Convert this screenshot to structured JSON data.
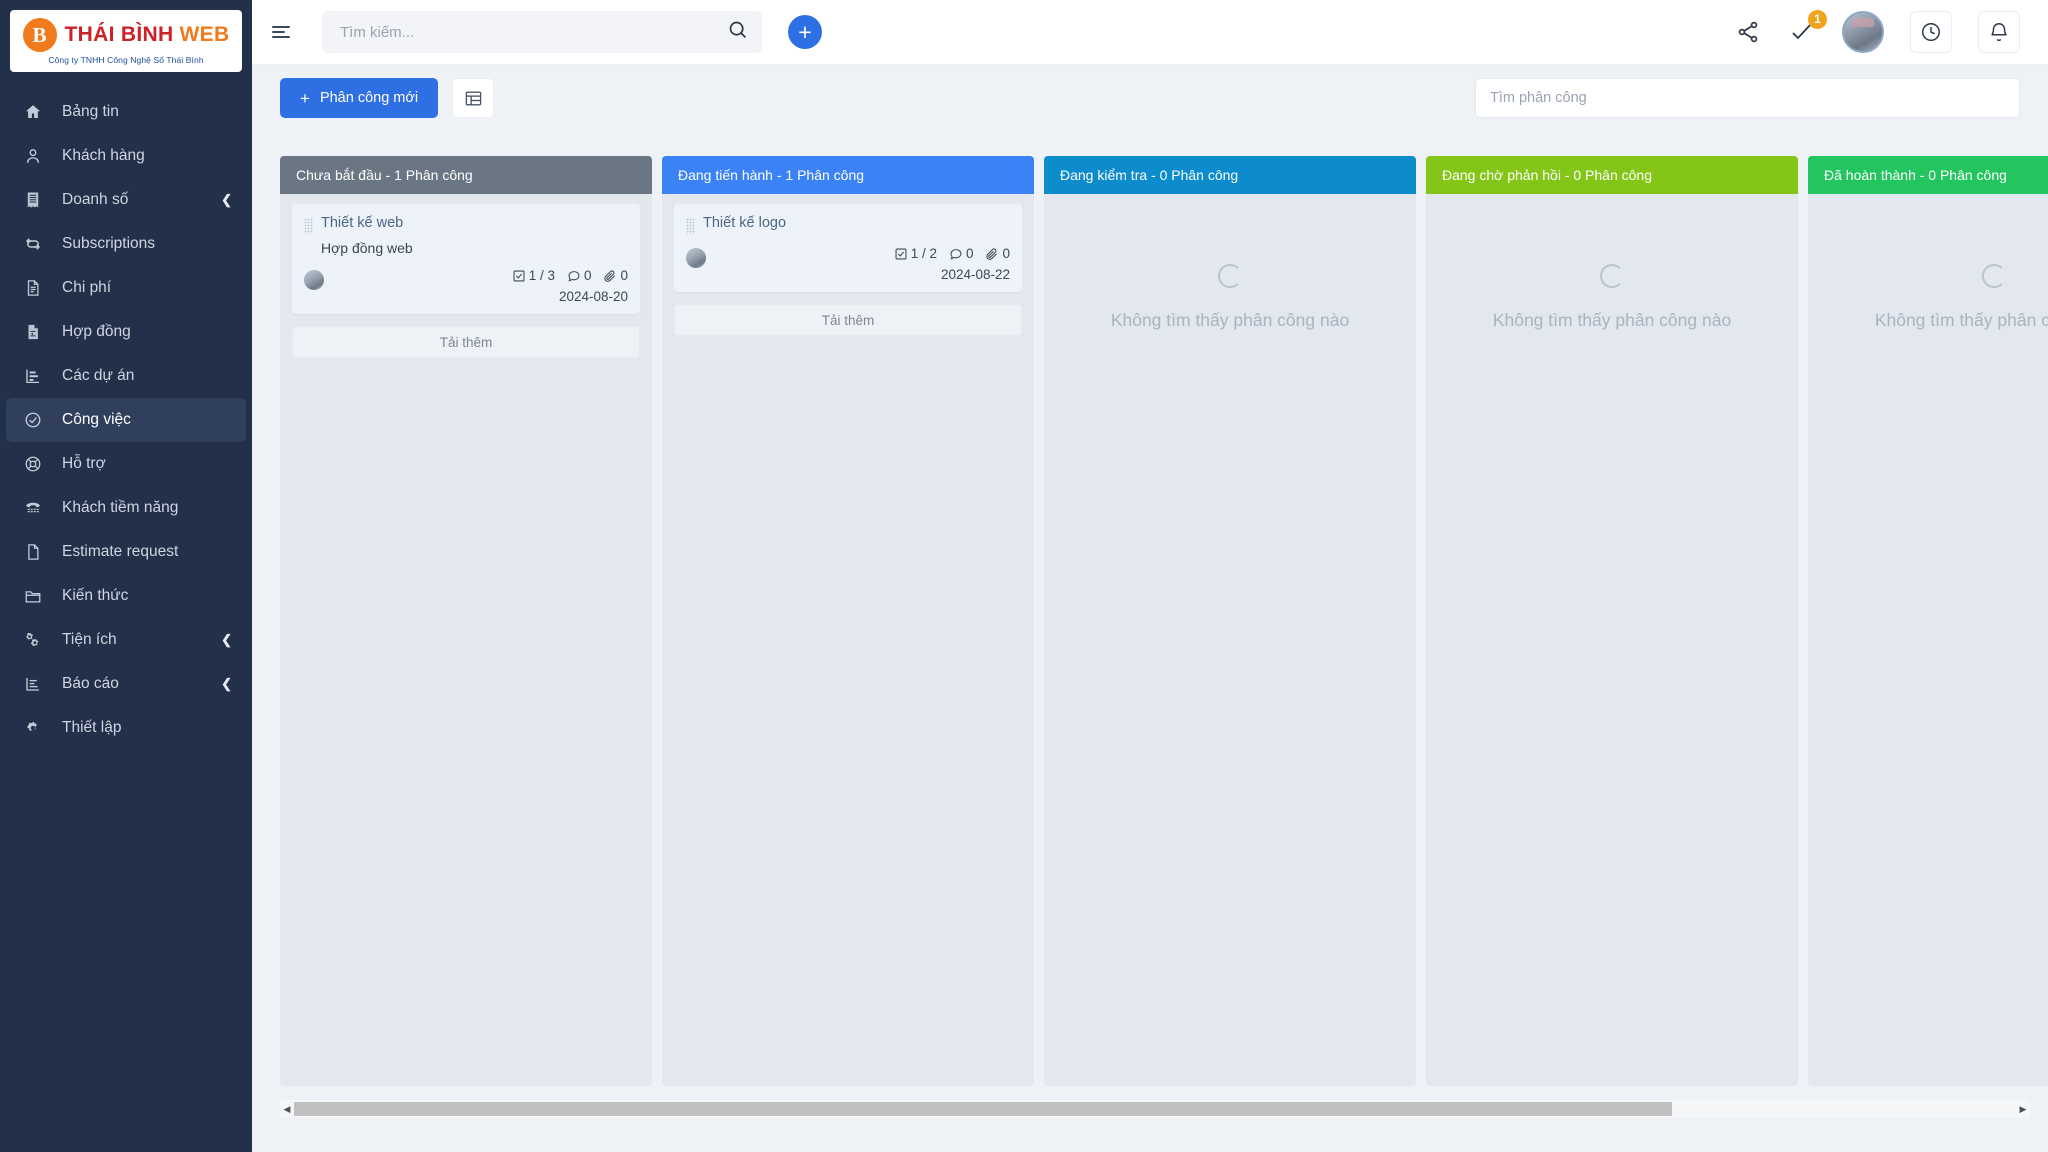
{
  "brand": {
    "mark": "B",
    "name_part1": "THÁI BÌNH",
    "name_part2": "WEB",
    "tagline": "Công ty TNHH Công Nghệ Số Thái Bình"
  },
  "sidebar": {
    "items": [
      {
        "label": "Bảng tin",
        "icon": "home-icon",
        "active": false,
        "chevron": false
      },
      {
        "label": "Khách hàng",
        "icon": "user-icon",
        "active": false,
        "chevron": false
      },
      {
        "label": "Doanh số",
        "icon": "receipt-icon",
        "active": false,
        "chevron": true
      },
      {
        "label": "Subscriptions",
        "icon": "refresh-icon",
        "active": false,
        "chevron": false
      },
      {
        "label": "Chi phí",
        "icon": "document-icon",
        "active": false,
        "chevron": false
      },
      {
        "label": "Hợp đồng",
        "icon": "contract-icon",
        "active": false,
        "chevron": false
      },
      {
        "label": "Các dự án",
        "icon": "chart-bar-icon",
        "active": false,
        "chevron": false
      },
      {
        "label": "Công việc",
        "icon": "check-circle-icon",
        "active": true,
        "chevron": false
      },
      {
        "label": "Hỗ trợ",
        "icon": "lifebuoy-icon",
        "active": false,
        "chevron": false
      },
      {
        "label": "Khách tiềm năng",
        "icon": "phone-icon",
        "active": false,
        "chevron": false
      },
      {
        "label": "Estimate request",
        "icon": "file-icon",
        "active": false,
        "chevron": false
      },
      {
        "label": "Kiến thức",
        "icon": "folder-icon",
        "active": false,
        "chevron": false
      },
      {
        "label": "Tiện ích",
        "icon": "gears-icon",
        "active": false,
        "chevron": true
      },
      {
        "label": "Báo cáo",
        "icon": "report-icon",
        "active": false,
        "chevron": true
      },
      {
        "label": "Thiết lập",
        "icon": "gear-icon",
        "active": false,
        "chevron": false
      }
    ],
    "chevron_glyph": "❮"
  },
  "header": {
    "search": {
      "value": "",
      "placeholder": "Tìm kiếm..."
    },
    "add_button_glyph": "+",
    "icons": [
      {
        "name": "share-icon"
      },
      {
        "name": "check-tasks-icon",
        "badge": "1"
      },
      {
        "name": "avatar"
      },
      {
        "name": "clock-icon"
      },
      {
        "name": "bell-icon"
      }
    ],
    "badge_count": "1"
  },
  "toolbar": {
    "new_assignment_label": "Phân công mới",
    "new_assignment_plus": "+",
    "grid_view_icon": "table-view-icon",
    "board_search": {
      "value": "",
      "placeholder": "Tìm phân công"
    }
  },
  "board": {
    "columns": [
      {
        "title": "Chưa bắt đầu - 1 Phân công",
        "color": "#6b7684",
        "empty": false,
        "load_more_label": "Tải thêm",
        "cards": [
          {
            "title": "Thiết kế web",
            "subtitle": "Hợp đồng web",
            "checklist": "1 / 3",
            "comments": "0",
            "attachments": "0",
            "date": "2024-08-20"
          }
        ]
      },
      {
        "title": "Đang tiến hành - 1 Phân công",
        "color": "#3b82f6",
        "empty": false,
        "load_more_label": "Tải thêm",
        "cards": [
          {
            "title": "Thiết kế logo",
            "subtitle": "",
            "checklist": "1 / 2",
            "comments": "0",
            "attachments": "0",
            "date": "2024-08-22"
          }
        ]
      },
      {
        "title": "Đang kiểm tra - 0 Phân công",
        "color": "#0c8ccd",
        "empty": true,
        "empty_text": "Không tìm thấy phân công nào",
        "cards": []
      },
      {
        "title": "Đang chờ phản hồi - 0 Phân công",
        "color": "#84c618",
        "empty": true,
        "empty_text": "Không tìm thấy phân công nào",
        "cards": []
      },
      {
        "title": "Đã hoàn thành - 0 Phân công",
        "color": "#22c55e",
        "empty": true,
        "empty_text": "Không tìm thấy phân công nào",
        "cards": []
      }
    ]
  },
  "scrollbar": {
    "left_arrow": "◀",
    "right_arrow": "▶",
    "thumb_percent": 80
  }
}
